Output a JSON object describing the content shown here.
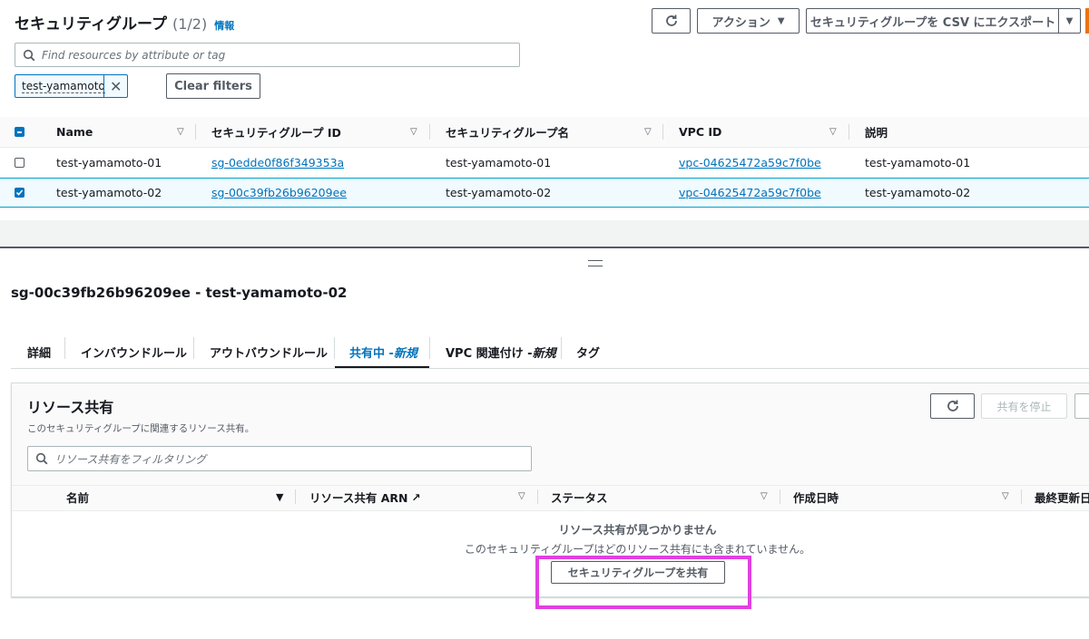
{
  "header": {
    "title": "セキュリティグループ",
    "count": "(1/2)",
    "info": "情報",
    "actions_label": "アクション",
    "export_label": "セキュリティグループを CSV にエクスポート"
  },
  "search": {
    "placeholder": "Find resources by attribute or tag"
  },
  "filter_token": "test-yamamoto",
  "clear_filters": "Clear filters",
  "table": {
    "columns": [
      "Name",
      "セキュリティグループ ID",
      "セキュリティグループ名",
      "VPC ID",
      "説明"
    ],
    "rows": [
      {
        "name": "test-yamamoto-01",
        "sg_id": "sg-0edde0f86f349353a",
        "sg_name": "test-yamamoto-01",
        "vpc_id": "vpc-04625472a59c7f0be",
        "desc": "test-yamamoto-01",
        "checked": false
      },
      {
        "name": "test-yamamoto-02",
        "sg_id": "sg-00c39fb26b96209ee",
        "sg_name": "test-yamamoto-02",
        "vpc_id": "vpc-04625472a59c7f0be",
        "desc": "test-yamamoto-02",
        "checked": true
      }
    ]
  },
  "details": {
    "title": "sg-00c39fb26b96209ee - test-yamamoto-02",
    "tabs": [
      {
        "label": "詳細",
        "new": ""
      },
      {
        "label": "インバウンドルール",
        "new": ""
      },
      {
        "label": "アウトバウンドルール",
        "new": ""
      },
      {
        "label": "共有中 - ",
        "new": "新規"
      },
      {
        "label": "VPC 関連付け - ",
        "new": "新規"
      },
      {
        "label": "タグ",
        "new": ""
      }
    ]
  },
  "resource_share": {
    "title": "リソース共有",
    "description": "このセキュリティグループに関連するリソース共有。",
    "stop_label": "共有を停止",
    "filter_placeholder": "リソース共有をフィルタリング",
    "columns": [
      "名前",
      "リソース共有 ARN",
      "ステータス",
      "作成日時",
      "最終更新日"
    ],
    "empty_title": "リソース共有が見つかりません",
    "empty_desc": "このセキュリティグループはどのリソース共有にも含まれていません。",
    "share_button": "セキュリティグループを共有"
  },
  "colors": {
    "accent": "#0073bb",
    "highlight": "#e040e0",
    "selected_row": "#f1faff",
    "orange": "#ec7211"
  }
}
